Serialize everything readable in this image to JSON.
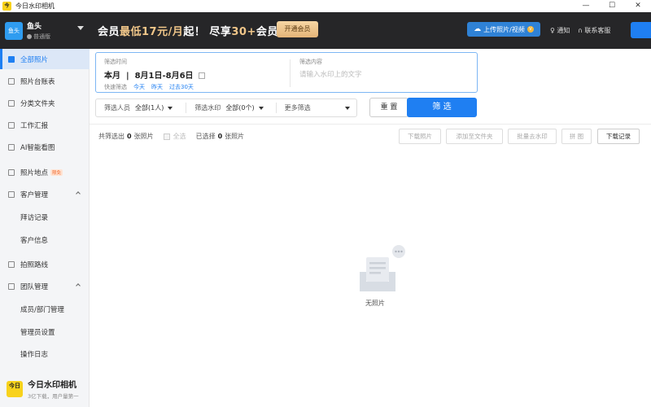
{
  "window": {
    "logo_text": "今日",
    "title": "今日水印相机",
    "minimize": "—",
    "maximize": "☐",
    "close": "✕"
  },
  "account": {
    "avatar_text": "鱼头",
    "name": "鱼头",
    "level": "普通版"
  },
  "promo": {
    "prefix": "会员",
    "highlight1": "最低17元/月",
    "middle": "起！ 尽享",
    "highlight2": "30+",
    "suffix": "会员权益",
    "button": "开通会员"
  },
  "header": {
    "upload_label": "上传照片/视频",
    "vip_icon": "V",
    "notify_label": "通知",
    "service_label": "联系客服"
  },
  "sidebar": {
    "items": [
      {
        "label": "全部照片",
        "icon": "photo-icon",
        "active": true
      },
      {
        "label": "照片台账表",
        "icon": "table-icon"
      },
      {
        "label": "分类文件夹",
        "icon": "folder-icon"
      },
      {
        "label": "工作汇报",
        "icon": "report-icon"
      },
      {
        "label": "AI智能看图",
        "icon": "ai-icon"
      },
      {
        "label": "照片地点",
        "icon": "location-icon",
        "badge": "限免"
      },
      {
        "label": "客户管理",
        "icon": "customer-icon",
        "group": true
      },
      {
        "label": "拜访记录",
        "sub": true
      },
      {
        "label": "客户信息",
        "sub": true
      },
      {
        "label": "拍照路线",
        "icon": "route-icon"
      },
      {
        "label": "团队管理",
        "icon": "team-icon",
        "group": true
      },
      {
        "label": "成员/部门管理",
        "sub": true
      },
      {
        "label": "管理员设置",
        "sub": true
      },
      {
        "label": "操作日志",
        "sub": true
      }
    ]
  },
  "brand": {
    "logo_text": "今日",
    "name": "今日水印相机",
    "slogan": "3亿下载，用户量第一"
  },
  "date_filter": {
    "label": "筛选时间",
    "range_prefix": "本月",
    "range": "8月1日-8月6日",
    "quick_label": "快速筛选",
    "quick": [
      "今天",
      "昨天",
      "过去30天"
    ],
    "content_label": "筛选内容",
    "content_placeholder": "请输入水印上的文字"
  },
  "filters": {
    "person_label": "筛选人员",
    "person_value": "全部(1人)",
    "watermark_label": "筛选水印",
    "watermark_value": "全部(0个)",
    "more_label": "更多筛选",
    "reset": "重 置",
    "apply": "筛 选"
  },
  "results": {
    "found_prefix": "共筛选出",
    "found_count": "0",
    "found_suffix": "张照片",
    "select_all": "全选",
    "selected_prefix": "已选择",
    "selected_count": "0",
    "selected_suffix": "张照片"
  },
  "actions": {
    "download": "下载照片",
    "add_folder": "添加至文件夹",
    "remove_wm": "批量去水印",
    "merge": "拼 图",
    "records": "下载记录"
  },
  "empty": {
    "label": "无照片"
  }
}
